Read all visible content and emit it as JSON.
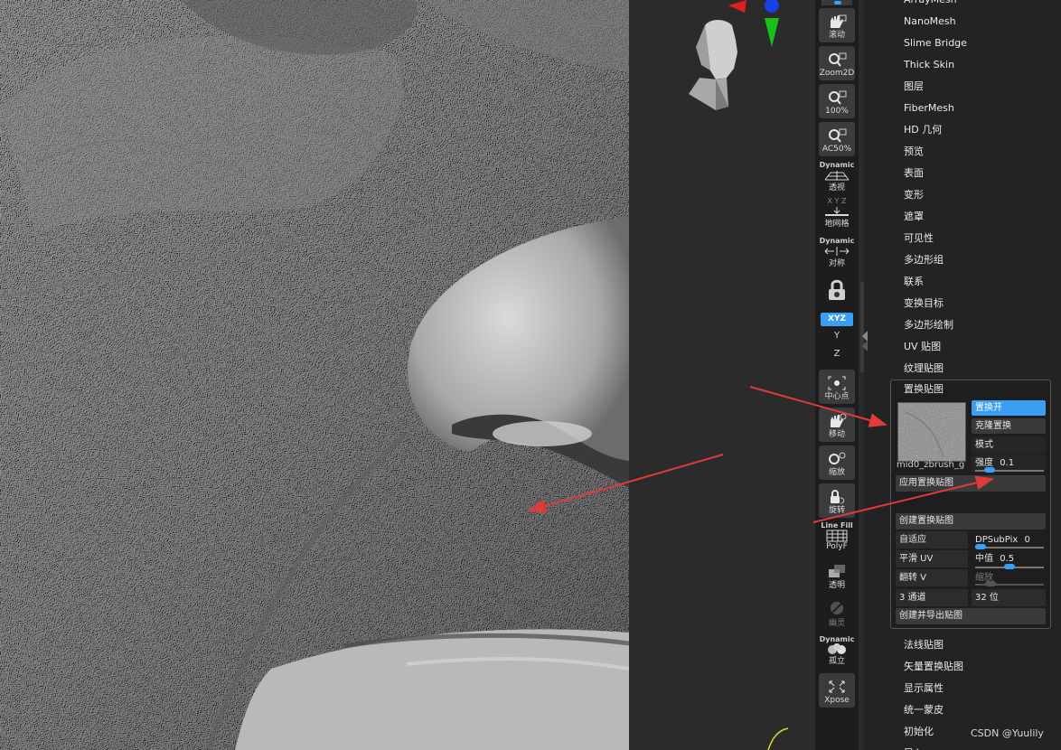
{
  "shelf": {
    "tools": [
      {
        "label": "滚动",
        "icon": "hand-scroll-icon"
      },
      {
        "label": "Zoom2D",
        "icon": "zoom-2d-icon"
      },
      {
        "label": "100%",
        "icon": "zoom-100-icon"
      },
      {
        "label": "AC50%",
        "icon": "zoom-ac50-icon"
      },
      {
        "label": "透视",
        "icon": "perspective-grid-icon"
      },
      {
        "label": "地网格",
        "icon": "floor-grid-icon"
      },
      {
        "label": "对称",
        "icon": "symmetry-icon"
      },
      {
        "label": "中心点",
        "icon": "center-point-icon"
      },
      {
        "label": "移动",
        "icon": "move-hand-icon"
      },
      {
        "label": "缩放",
        "icon": "scale-icon"
      },
      {
        "label": "旋转",
        "icon": "rotate-icon"
      },
      {
        "label": "PolyF",
        "icon": "polyframe-icon"
      },
      {
        "label": "透明",
        "icon": "transparent-icon"
      },
      {
        "label": "幽灵",
        "icon": "ghost-icon"
      },
      {
        "label": "孤立",
        "icon": "solo-icon"
      },
      {
        "label": "Xpose",
        "icon": "xpose-icon"
      }
    ],
    "dynamic1": "Dynamic",
    "dynamic2": "Dynamic",
    "dynamic3": "Dynamic",
    "line_fill": "Line Fill",
    "xyz_label": "XYZ",
    "axis_y": "Y",
    "axis_z": "Z",
    "axis_hint": "X Y Z"
  },
  "menu": {
    "items_top": [
      "ArrayMesh",
      "NanoMesh",
      "Slime Bridge",
      "Thick Skin",
      "图层",
      "FiberMesh",
      "HD 几何",
      "预览",
      "表面",
      "变形",
      "遮罩",
      "可见性",
      "多边形组",
      "联系",
      "变换目标",
      "多边形绘制",
      "UV 贴图",
      "纹理贴图"
    ],
    "items_bottom": [
      "法线贴图",
      "矢量置换贴图",
      "显示属性",
      "统一蒙皮",
      "初始化",
      "导入"
    ]
  },
  "displacement": {
    "title": "置换贴图",
    "thumb_name": "mid0_zbrush_g",
    "on_label": "置换开",
    "clone_label": "克隆置换",
    "mode_label": "模式",
    "intensity_label": "强度",
    "intensity_value": "0.1",
    "intensity_level": 0.15,
    "apply_label": "应用置换贴图",
    "create_label": "创建置换贴图",
    "adaptive_label": "自适应",
    "dpsubpix_label": "DPSubPix",
    "dpsubpix_value": "0",
    "dpsubpix_level": 0.0,
    "smooth_uv_label": "平滑 UV",
    "mid_label": "中值",
    "mid_value": "0.5",
    "mid_level": 0.5,
    "flip_v_label": "翻转 V",
    "scale_label": "缩放",
    "channels_label": "3 通道",
    "bits_label": "32 位",
    "create_export_label": "创建并导出贴图"
  },
  "watermark": "CSDN @Yuulily",
  "colors": {
    "accent": "#3a9ef2",
    "annotation_arrow": "#e03a3a"
  }
}
